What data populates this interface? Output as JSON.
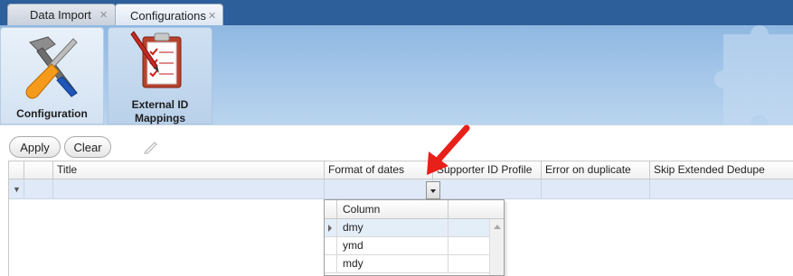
{
  "tabs": [
    {
      "label": "Data Import",
      "active": false
    },
    {
      "label": "Configurations",
      "active": true
    }
  ],
  "ribbon": {
    "configuration_label": "Configuration",
    "external_id_label_line1": "External ID",
    "external_id_label_line2": "Mappings"
  },
  "toolbar": {
    "apply_label": "Apply",
    "clear_label": "Clear"
  },
  "grid": {
    "columns": [
      "Title",
      "Format of dates",
      "Supporter ID Profile",
      "Error on duplicate",
      "Skip Extended Dedupe"
    ]
  },
  "dropdown": {
    "column_header": "Column",
    "options": [
      "dmy",
      "ymd",
      "mdy"
    ],
    "selected": "dmy"
  },
  "colors": {
    "tab_strip": "#2d5f9a",
    "ribbon": "#a9c9ea",
    "filter_row": "#dfe9f7",
    "annotation_arrow": "#e8201a"
  }
}
